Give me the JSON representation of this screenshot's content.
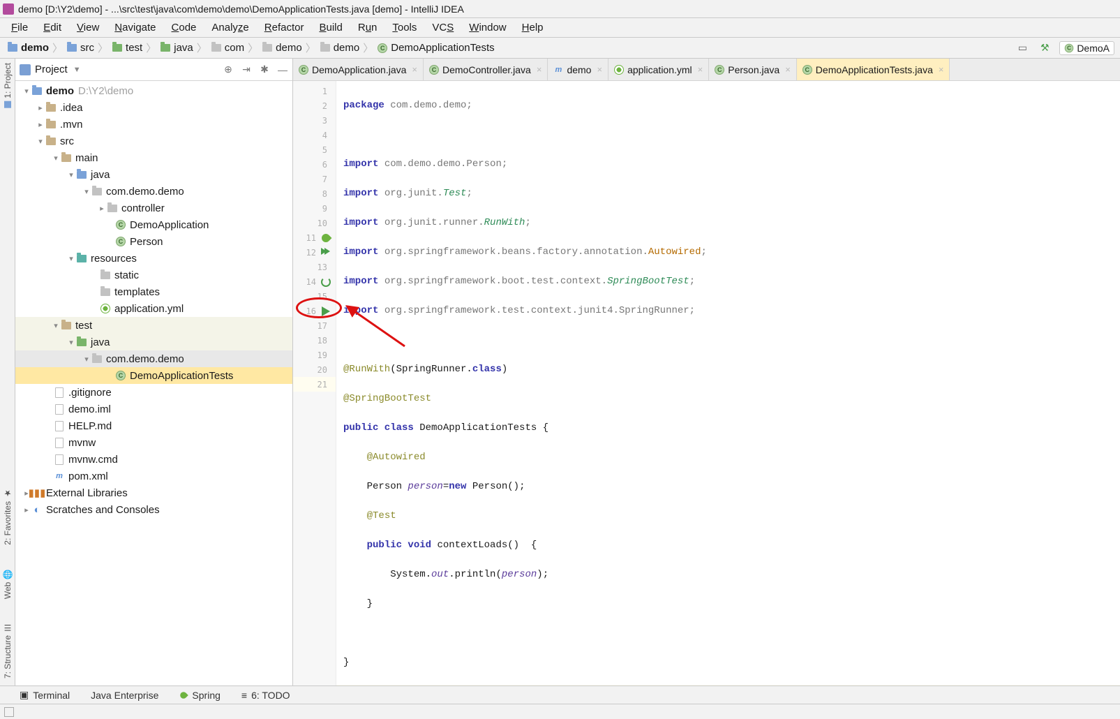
{
  "title": "demo [D:\\Y2\\demo] - ...\\src\\test\\java\\com\\demo\\demo\\DemoApplicationTests.java [demo] - IntelliJ IDEA",
  "menu": [
    "File",
    "Edit",
    "View",
    "Navigate",
    "Code",
    "Analyze",
    "Refactor",
    "Build",
    "Run",
    "Tools",
    "VCS",
    "Window",
    "Help"
  ],
  "menu_mn": [
    "F",
    "E",
    "V",
    "N",
    "C",
    "",
    "R",
    "B",
    "R",
    "T",
    "S",
    "W",
    "H"
  ],
  "breadcrumbs": [
    "demo",
    "src",
    "test",
    "java",
    "com",
    "demo",
    "demo",
    "DemoApplicationTests"
  ],
  "nav_run": "DemoA",
  "sidebar": {
    "title": "Project",
    "root_name": "demo",
    "root_path": "D:\\Y2\\demo",
    "nodes": {
      "idea": ".idea",
      "mvn": ".mvn",
      "src": "src",
      "main": "main",
      "java1": "java",
      "pkg1": "com.demo.demo",
      "controller": "controller",
      "demoapp": "DemoApplication",
      "person": "Person",
      "resources": "resources",
      "static": "static",
      "templates": "templates",
      "appyml": "application.yml",
      "test": "test",
      "java2": "java",
      "pkg2": "com.demo.demo",
      "tests": "DemoApplicationTests",
      "gitignore": ".gitignore",
      "iml": "demo.iml",
      "help": "HELP.md",
      "mvnw": "mvnw",
      "mvnwcmd": "mvnw.cmd",
      "pom": "pom.xml",
      "extlib": "External Libraries",
      "scratches": "Scratches and Consoles"
    }
  },
  "stripes": {
    "project": "1: Project",
    "favorites": "2: Favorites",
    "web": "Web",
    "structure": "7: Structure"
  },
  "tabs": [
    {
      "label": "DemoApplication.java",
      "icon": "class"
    },
    {
      "label": "DemoController.java",
      "icon": "class"
    },
    {
      "label": "demo",
      "icon": "maven"
    },
    {
      "label": "application.yml",
      "icon": "spring"
    },
    {
      "label": "Person.java",
      "icon": "class"
    },
    {
      "label": "DemoApplicationTests.java",
      "icon": "class",
      "selected": true
    }
  ],
  "toolwindows": {
    "terminal": "Terminal",
    "javaee": "Java Enterprise",
    "spring": "Spring",
    "todo": "6: TODO"
  },
  "code": {
    "l1": {
      "t": "package ",
      "p": "com.demo.demo;",
      "indent": 0
    },
    "l3": {
      "t": "import ",
      "p": "com.demo.demo.Person;"
    },
    "l4a": "import ",
    "l4b": "org.junit.",
    "l4c": "Test",
    "l4d": ";",
    "l5a": "import ",
    "l5b": "org.junit.runner.",
    "l5c": "RunWith",
    "l5d": ";",
    "l6a": "import ",
    "l6b": "org.springframework.beans.factory.annotation.",
    "l6c": "Autowired",
    "l6d": ";",
    "l7a": "import ",
    "l7b": "org.springframework.boot.test.context.",
    "l7c": "SpringBootTest",
    "l7d": ";",
    "l8a": "import ",
    "l8b": "org.springframework.test.context.junit4.SpringRunner;",
    "l10a": "@RunWith",
    "l10b": "(SpringRunner.",
    "l10c": "class",
    "l10d": ")",
    "l11": "@SpringBootTest",
    "l12a": "public class ",
    "l12b": "DemoApplicationTests {",
    "l13": "@Autowired",
    "l14a": "Person ",
    "l14b": "person",
    "l14c": "=",
    "l14d": "new ",
    "l14e": "Person();",
    "l15": "@Test",
    "l16a": "public void ",
    "l16b": "contextLoads()  {",
    "l17a": "System.",
    "l17b": "out",
    "l17c": ".println(",
    "l17d": "person",
    "l17e": ");",
    "l18": "}",
    "l20": "}"
  }
}
